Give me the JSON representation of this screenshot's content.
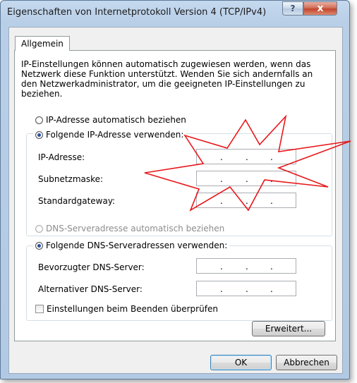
{
  "window": {
    "title": "Eigenschaften von Internetprotokoll Version 4 (TCP/IPv4)",
    "help_label": "?",
    "close_label": "x"
  },
  "tab": {
    "label": "Allgemein"
  },
  "description": "IP-Einstellungen können automatisch zugewiesen werden, wenn das Netzwerk diese Funktion unterstützt. Wenden Sie sich andernfalls an den Netzwerkadministrator, um die geeigneten IP-Einstellungen zu beziehen.",
  "ip": {
    "auto_label": "IP-Adresse automatisch beziehen",
    "manual_label": "Folgende IP-Adresse verwenden:",
    "fields": [
      {
        "label": "IP-Adresse:"
      },
      {
        "label": "Subnetzmaske:"
      },
      {
        "label": "Standardgateway:"
      }
    ]
  },
  "dns": {
    "auto_label": "DNS-Serveradresse automatisch beziehen",
    "manual_label": "Folgende DNS-Serveradressen verwenden:",
    "fields": [
      {
        "label": "Bevorzugter DNS-Server:"
      },
      {
        "label": "Alternativer DNS-Server:"
      }
    ]
  },
  "validate_label": "Einstellungen beim Beenden überprüfen",
  "buttons": {
    "advanced": "Erweitert...",
    "ok": "OK",
    "cancel": "Abbrechen"
  },
  "colors": {
    "starburst": "#e8171a",
    "titlebar": "#b9cfe8",
    "close": "#c2452c"
  }
}
